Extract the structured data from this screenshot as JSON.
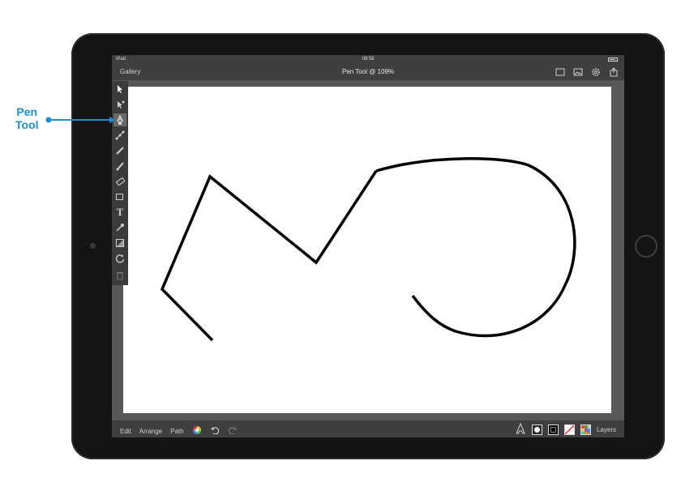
{
  "status_bar": {
    "carrier": "iPad",
    "time": "08:58"
  },
  "nav_bar": {
    "gallery": "Gallery",
    "title": "Pen Tool @ 109%"
  },
  "bottom_bar": {
    "edit": "Edit",
    "arrange": "Arrange",
    "path": "Path",
    "layers": "Layers"
  },
  "annotation": {
    "line1": "Pen",
    "line2": "Tool"
  },
  "colors": {
    "accent": "#1a8fd8",
    "device": "#141414",
    "chrome": "#3f3f3f",
    "canvas_bg": "#585858",
    "stroke": "#000000"
  },
  "tools": [
    {
      "name": "select-tool-icon"
    },
    {
      "name": "node-tool-icon"
    },
    {
      "name": "pen-tool-icon",
      "selected": true
    },
    {
      "name": "point-transform-icon"
    },
    {
      "name": "knife-tool-icon"
    },
    {
      "name": "brush-tool-icon"
    },
    {
      "name": "eraser-tool-icon"
    },
    {
      "name": "shape-tool-icon"
    },
    {
      "name": "text-tool-icon"
    },
    {
      "name": "eyedropper-tool-icon"
    },
    {
      "name": "fill-tool-icon"
    },
    {
      "name": "rotate-tool-icon"
    },
    {
      "name": "trash-icon"
    }
  ]
}
